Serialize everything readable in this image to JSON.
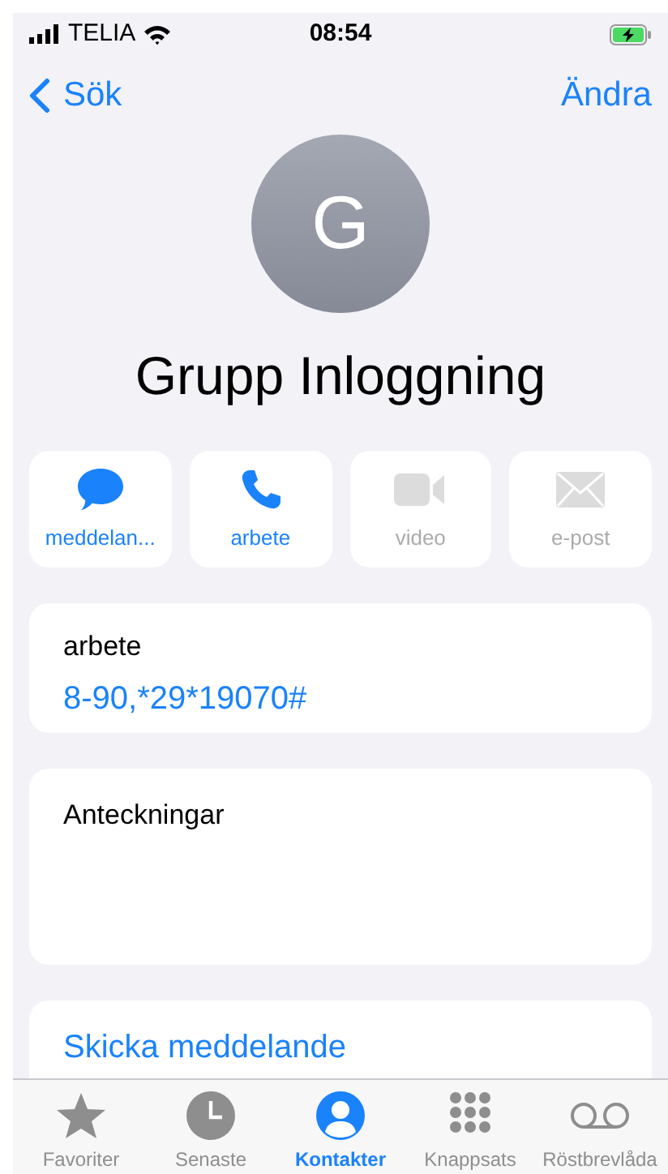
{
  "status_bar": {
    "carrier": "TELIA",
    "time": "08:54",
    "charging": true
  },
  "nav": {
    "back": "Sök",
    "action": "Ändra"
  },
  "contact": {
    "initial": "G",
    "name": "Grupp Inloggning"
  },
  "actions": [
    {
      "kind": "message",
      "label": "meddelan...",
      "disabled": false
    },
    {
      "kind": "phone",
      "label": "arbete",
      "disabled": false
    },
    {
      "kind": "video",
      "label": "video",
      "disabled": true
    },
    {
      "kind": "mail",
      "label": "e-post",
      "disabled": true
    }
  ],
  "phone_card": {
    "label": "arbete",
    "value": "8-90,*29*19070#"
  },
  "notes_card": {
    "label": "Anteckningar"
  },
  "send_message": "Skicka meddelande",
  "tabs": [
    {
      "kind": "star",
      "label": "Favoriter",
      "selected": false
    },
    {
      "kind": "clock",
      "label": "Senaste",
      "selected": false
    },
    {
      "kind": "person",
      "label": "Kontakter",
      "selected": true
    },
    {
      "kind": "keypad",
      "label": "Knappsats",
      "selected": false
    },
    {
      "kind": "voicemail",
      "label": "Röstbrevlåda",
      "selected": false
    }
  ]
}
